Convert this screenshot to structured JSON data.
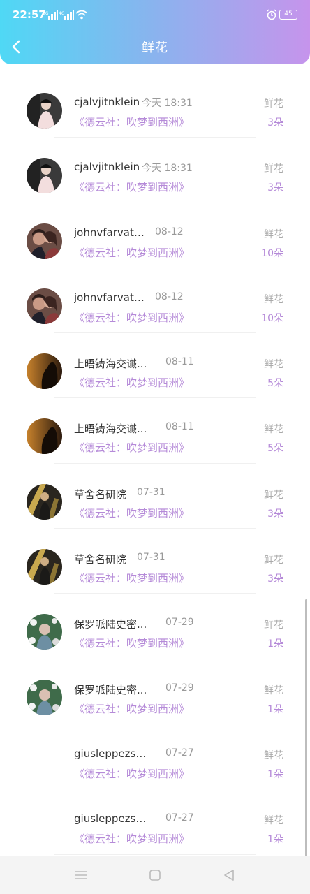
{
  "status_bar": {
    "time": "22:57",
    "battery": "45"
  },
  "header": {
    "title": "鲜花"
  },
  "colors": {
    "accent": "#b58ad8",
    "gradient_start": "#4fd8f5",
    "gradient_end": "#c694ec"
  },
  "items": [
    {
      "name": "cjalvjitnklein",
      "time": "今天 18:31",
      "program": "《德云社：吹梦到西洲》",
      "gift": "鲜花",
      "count": "3朵",
      "avatar": "avatar-man-dark"
    },
    {
      "name": "cjalvjitnklein",
      "time": "今天 18:31",
      "program": "《德云社：吹梦到西洲》",
      "gift": "鲜花",
      "count": "3朵",
      "avatar": "avatar-man-dark"
    },
    {
      "name": "johnvfarvatous",
      "time": "08-12",
      "program": "《德云社：吹梦到西洲》",
      "gift": "鲜花",
      "count": "10朵",
      "avatar": "avatar-couple"
    },
    {
      "name": "johnvfarvatous",
      "time": "08-12",
      "program": "《德云社：吹梦到西洲》",
      "gift": "鲜花",
      "count": "10朵",
      "avatar": "avatar-couple"
    },
    {
      "name": "上晤铸海交谶...",
      "time": "08-11",
      "program": "《德云社：吹梦到西洲》",
      "gift": "鲜花",
      "count": "5朵",
      "avatar": "avatar-silhouette-warm"
    },
    {
      "name": "上晤铸海交谶...",
      "time": "08-11",
      "program": "《德云社：吹梦到西洲》",
      "gift": "鲜花",
      "count": "5朵",
      "avatar": "avatar-silhouette-warm"
    },
    {
      "name": "草舍名研院",
      "time": "07-31",
      "program": "《德云社：吹梦到西洲》",
      "gift": "鲜花",
      "count": "3朵",
      "avatar": "avatar-gold"
    },
    {
      "name": "草舍名研院",
      "time": "07-31",
      "program": "《德云社：吹梦到西洲》",
      "gift": "鲜花",
      "count": "3朵",
      "avatar": "avatar-gold"
    },
    {
      "name": "保罗哌陆史密...",
      "time": "07-29",
      "program": "《德云社：吹梦到西洲》",
      "gift": "鲜花",
      "count": "1朵",
      "avatar": "avatar-floral"
    },
    {
      "name": "保罗哌陆史密...",
      "time": "07-29",
      "program": "《德云社：吹梦到西洲》",
      "gift": "鲜花",
      "count": "1朵",
      "avatar": "avatar-floral"
    },
    {
      "name": "giusleppezsax...",
      "time": "07-27",
      "program": "《德云社：吹梦到西洲》",
      "gift": "鲜花",
      "count": "1朵",
      "avatar": "none"
    },
    {
      "name": "giusleppezsax...",
      "time": "07-27",
      "program": "《德云社：吹梦到西洲》",
      "gift": "鲜花",
      "count": "1朵",
      "avatar": "none"
    }
  ]
}
